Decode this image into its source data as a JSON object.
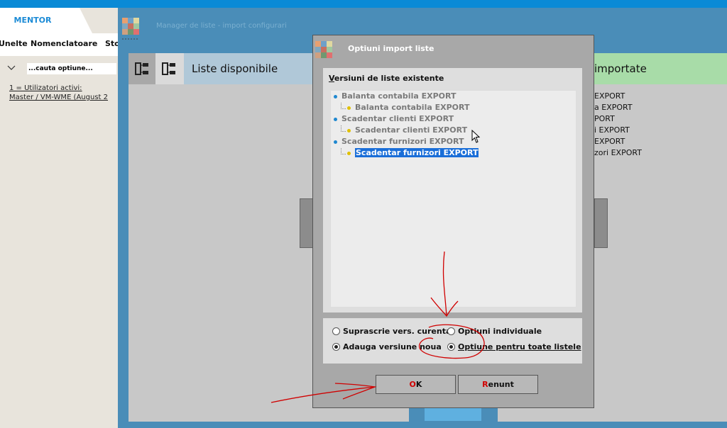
{
  "app": {
    "brand": "MENTOR",
    "menu": [
      "Unelte",
      "Nomenclatoare",
      "Sto"
    ],
    "search_placeholder": "...cauta optiune...",
    "info_lines": [
      "1 = Utilizatori activi:",
      "Master / VM-WME (August 2"
    ]
  },
  "manager": {
    "title": "Manager de liste - import configurari",
    "available_title": "Liste disponibile",
    "imported_title": "importate",
    "imported_items": [
      "EXPORT",
      "a EXPORT",
      "PORT",
      "i EXPORT",
      "EXPORT",
      "zori EXPORT"
    ]
  },
  "dialog": {
    "title": "Optiuni import liste",
    "group_label_first": "V",
    "group_label_rest": "ersiuni de liste existente",
    "tree": [
      {
        "label": "Balanta contabila EXPORT",
        "child": "Balanta contabila EXPORT"
      },
      {
        "label": "Scadentar clienti EXPORT",
        "child": "Scadentar clienti EXPORT"
      },
      {
        "label": "Scadentar furnizori EXPORT",
        "child": "Scadentar furnizori EXPORT"
      }
    ],
    "options": {
      "overwrite": "Suprascrie vers. curenta",
      "add_new": "Adauga versiune noua",
      "individual": "Optiuni individuale",
      "all_lists": "Optiune pentru toate listele",
      "selected_mode": "Adauga versiune noua",
      "selected_scope": "Optiune pentru toate listele"
    },
    "ok_accel": "O",
    "ok_rest": "K",
    "cancel_accel": "R",
    "cancel_rest": "enunt"
  },
  "colors": {
    "accent_blue": "#0a8ad6",
    "window_blue": "#4a8db8",
    "imported_green": "#a8dca8",
    "selection": "#1a6ed8",
    "annotation_red": "#d00000"
  }
}
